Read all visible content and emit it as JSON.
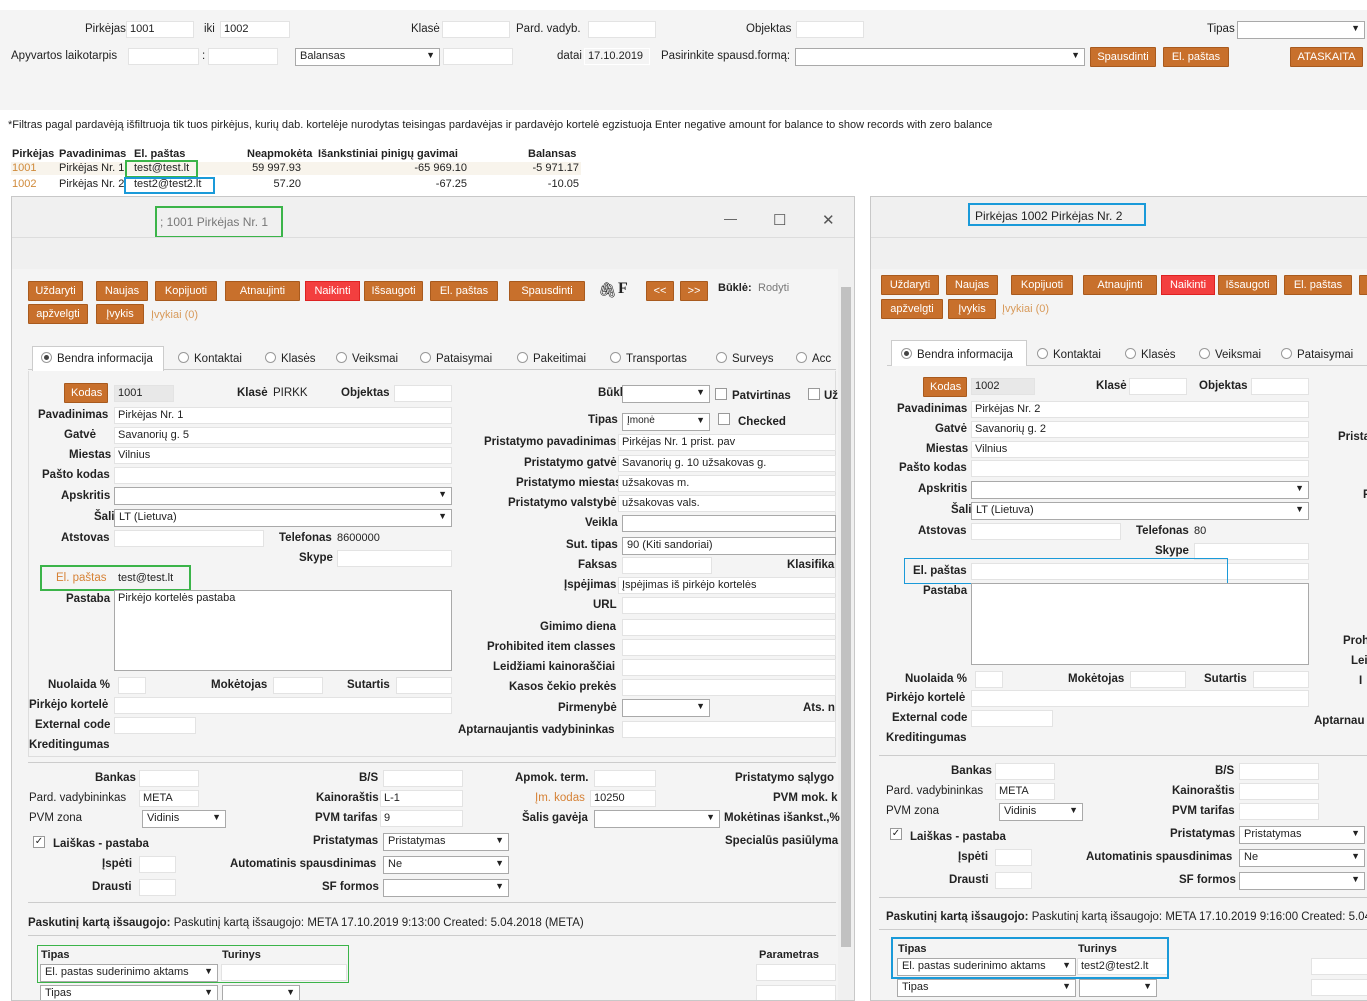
{
  "top": {
    "pirkejas_label": "Pirkėjas",
    "pirkejas_from": "1001",
    "iki_label": "iki",
    "pirkejas_to": "1002",
    "klase_label": "Klasė",
    "pard_vadyb_label": "Pard. vadyb.",
    "objektas_label": "Objektas",
    "tipas_label": "Tipas",
    "apyvartos_label": "Apyvartos laikotarpis",
    "colon": ":",
    "balansas_value": "Balansas",
    "datai_label": "datai",
    "datai_value": "17.10.2019",
    "pasirinkite_label": "Pasirinkite spausd.formą:",
    "spausdinti": "Spausdinti",
    "el_pastas": "El. paštas",
    "ataskaita": "ATASKAITA"
  },
  "filter_note": "*Filtras pagal pardavėją išfiltruoja tik tuos pirkėjus, kurių dab. kortelėje nurodytas teisingas pardavėjas ir pardavėjo kortelė egzistuoja Enter negative amount for balance to show records with zero balance",
  "report": {
    "headers": [
      "Pirkėjas",
      "Pavadinimas",
      "El. paštas",
      "Neapmokėta",
      "Išankstiniai pinigų gavimai",
      "Balansas"
    ],
    "rows": [
      {
        "code": "1001",
        "name": "Pirkėjas Nr. 1",
        "email": "test@test.lt",
        "unpaid": "59 997.93",
        "advance": "-65 969.10",
        "balance": "-5 971.17"
      },
      {
        "code": "1002",
        "name": "Pirkėjas Nr. 2",
        "email": "test2@test2.lt",
        "unpaid": "57.20",
        "advance": "-67.25",
        "balance": "-10.05"
      }
    ]
  },
  "w1": {
    "title": "; 1001  Pirkėjas Nr. 1",
    "minimize": "—",
    "maximize": "☐",
    "close": "✕",
    "buttons": {
      "uzdaryti": "Uždaryti",
      "naujas": "Naujas",
      "kopijuoti": "Kopijuoti",
      "atnaujinti": "Atnaujinti",
      "naikinti": "Naikinti",
      "issaugoti": "Išsaugoti",
      "el_pastas": "El. paštas",
      "spausdinti": "Spausdinti",
      "prev": "<<",
      "next": ">>",
      "apzvelgti": "apžvelgti",
      "ivykis": "Įvykis"
    },
    "f_letter": "F",
    "bukle_label": "Būklė:",
    "bukle_value": "Rodyti",
    "ivykiai": "Įvykiai (0)",
    "tabs": [
      "Bendra informacija",
      "Kontaktai",
      "Klasės",
      "Veiksmai",
      "Pataisymai",
      "Pakeitimai",
      "Transportas",
      "Surveys",
      "Acc"
    ],
    "left": {
      "kodas_btn": "Kodas",
      "kodas": "1001",
      "klase_label": "Klasė",
      "klase": "PIRKK",
      "objektas_label": "Objektas",
      "pavadinimas_label": "Pavadinimas",
      "pavadinimas": "Pirkėjas Nr. 1",
      "gatve_label": "Gatvė",
      "gatve": "Savanorių g. 5",
      "miestas_label": "Miestas",
      "miestas": "Vilnius",
      "pasto_label": "Pašto kodas",
      "apskritis_label": "Apskritis",
      "salis_label": "Šalis",
      "salis": "LT (Lietuva)",
      "atstovas_label": "Atstovas",
      "telefonas_label": "Telefonas",
      "telefonas": "8600000",
      "skype_label": "Skype",
      "elp_label": "El. paštas",
      "elp": "test@test.lt",
      "pastaba_label": "Pastaba",
      "pastaba": "Pirkėjo kortelės pastaba",
      "nuolaida_label": "Nuolaida %",
      "moketojas_label": "Mokėtojas",
      "sutartis_label": "Sutartis",
      "pk_label": "Pirkėjo kortelė",
      "ext_label": "External code",
      "kred_label": "Kreditingumas"
    },
    "right": {
      "bukle_label": "Būklė",
      "patvirtinas": "Patvirtinas",
      "uz": "Už",
      "tipas_label": "Tipas",
      "tipas": "Įmonė",
      "checked": "Checked",
      "pp_label": "Pristatymo pavadinimas",
      "pp": "Pirkėjas Nr. 1 prist. pav",
      "pg_label": "Pristatymo gatvė",
      "pg": "Savanorių g. 10 užsakovas g.",
      "pm_label": "Pristatymo miestas",
      "pm": "užsakovas m.",
      "pv_label": "Pristatymo valstybė",
      "pv": "užsakovas vals.",
      "veikla_label": "Veikla",
      "sut_label": "Sut. tipas",
      "sut": "90 (Kiti sandoriai)",
      "faksas_label": "Faksas",
      "klasif": "Klasifika",
      "ispejimas_label": "Įspėjimas",
      "ispejimas": "Įspėjimas iš pirkėjo kortelės",
      "url_label": "URL",
      "gim_label": "Gimimo diena",
      "prohib_label": "Prohibited item classes",
      "leid_label": "Leidžiami kainoraščiai",
      "kasos_label": "Kasos čekio prekės",
      "pirm_label": "Pirmenybė",
      "atsn": "Ats. n",
      "aptar_label": "Aptarnaujantis vadybininkas"
    },
    "lower": {
      "bankas_label": "Bankas",
      "bs_label": "B/S",
      "apmok_label": "Apmok. term.",
      "prist_salyg": "Pristatymo sąlygo",
      "pard_label": "Pard. vadybininkas",
      "pard": "META",
      "kain_label": "Kainoraštis",
      "kain": "L-1",
      "im_kodas_label": "Įm. kodas",
      "im_kodas": "10250",
      "pvm_mok": "PVM mok. k",
      "pvm_zona_label": "PVM zona",
      "pvm_zona": "Vidinis",
      "pvm_tar_label": "PVM tarifas",
      "pvm_tar": "9",
      "salis_gav_label": "Šalis gavėja",
      "mok_isanksto": "Mokėtinas išankst.,%",
      "laiskas": "Laiškas - pastaba",
      "prist_label": "Pristatymas",
      "prist": "Pristatymas",
      "spec": "Specialūs pasiūlyma",
      "ispeti_label": "Įspėti",
      "auto_label": "Automatinis spausdinimas",
      "auto": "Ne",
      "drausti_label": "Drausti",
      "sf_label": "SF formos"
    },
    "footer": "Paskutinį kartą išsaugojo:  META 17.10.2019 9:13:00   Created: 5.04.2018 (META)",
    "t_tipas": "Tipas",
    "t_turinys": "Turinys",
    "t_param": "Parametras",
    "row1_tipas": "El. pastas suderinimo aktams",
    "row2_tipas": "Tipas"
  },
  "w2": {
    "title": "Pirkėjas 1002  Pirkėjas Nr. 2",
    "buttons": {
      "uzdaryti": "Uždaryti",
      "naujas": "Naujas",
      "kopijuoti": "Kopijuoti",
      "atnaujinti": "Atnaujinti",
      "naikinti": "Naikinti",
      "issaugoti": "Išsaugoti",
      "el_pastas": "El. paštas",
      "apzvelgti": "apžvelgti",
      "ivykis": "Įvykis"
    },
    "ivykiai": "Įvykiai (0)",
    "tabs": [
      "Bendra informacija",
      "Kontaktai",
      "Klasės",
      "Veiksmai",
      "Pataisymai"
    ],
    "kodas_btn": "Kodas",
    "kodas": "1002",
    "klase_label": "Klasė",
    "objektas_label": "Objektas",
    "pavadinimas_label": "Pavadinimas",
    "pavadinimas": "Pirkėjas Nr. 2",
    "gatve_label": "Gatvė",
    "gatve": "Savanorių g. 2",
    "prista": "Prista",
    "miestas_label": "Miestas",
    "miestas": "Vilnius",
    "pasto_label": "Pašto kodas",
    "apskritis_label": "Apskritis",
    "p_trunc": "P",
    "salis_label": "Šalis",
    "salis": "LT (Lietuva)",
    "atstovas_label": "Atstovas",
    "telefonas_label": "Telefonas",
    "telefonas": "80",
    "skype_label": "Skype",
    "elp_label": "El. paštas",
    "pastaba_label": "Pastaba",
    "proh": "Proh",
    "lei": "Lei",
    "i_trunc": "I",
    "nuolaida_label": "Nuolaida %",
    "moketojas_label": "Mokėtojas",
    "sutartis_label": "Sutartis",
    "pk_label": "Pirkėjo kortelė",
    "ext_label": "External code",
    "aptarnau": "Aptarnau",
    "kred_label": "Kreditingumas",
    "bankas_label": "Bankas",
    "bs_label": "B/S",
    "pard_label": "Pard. vadybininkas",
    "pard": "META",
    "kain_label": "Kainoraštis",
    "pvm_zona_label": "PVM zona",
    "pvm_zona": "Vidinis",
    "pvm_tar_label": "PVM tarifas",
    "laiskas": "Laiškas - pastaba",
    "prist_label": "Pristatymas",
    "prist": "Pristatymas",
    "ispeti_label": "Įspėti",
    "auto_label": "Automatinis spausdinimas",
    "auto": "Ne",
    "drausti_label": "Drausti",
    "sf_label": "SF formos",
    "footer": "Paskutinį kartą išsaugojo:  META 17.10.2019 9:16:00   Created: 5.04.2018 (META)",
    "t_tipas": "Tipas",
    "t_turinys": "Turinys",
    "row1_tipas": "El. pastas suderinimo aktams",
    "row1_turinys": "test2@test2.lt",
    "row2_tipas": "Tipas"
  },
  "colors": {
    "orange": "#c8702c",
    "red": "#f33f3f",
    "green_highlight": "#3bb449",
    "blue_highlight": "#1a9ad9"
  }
}
